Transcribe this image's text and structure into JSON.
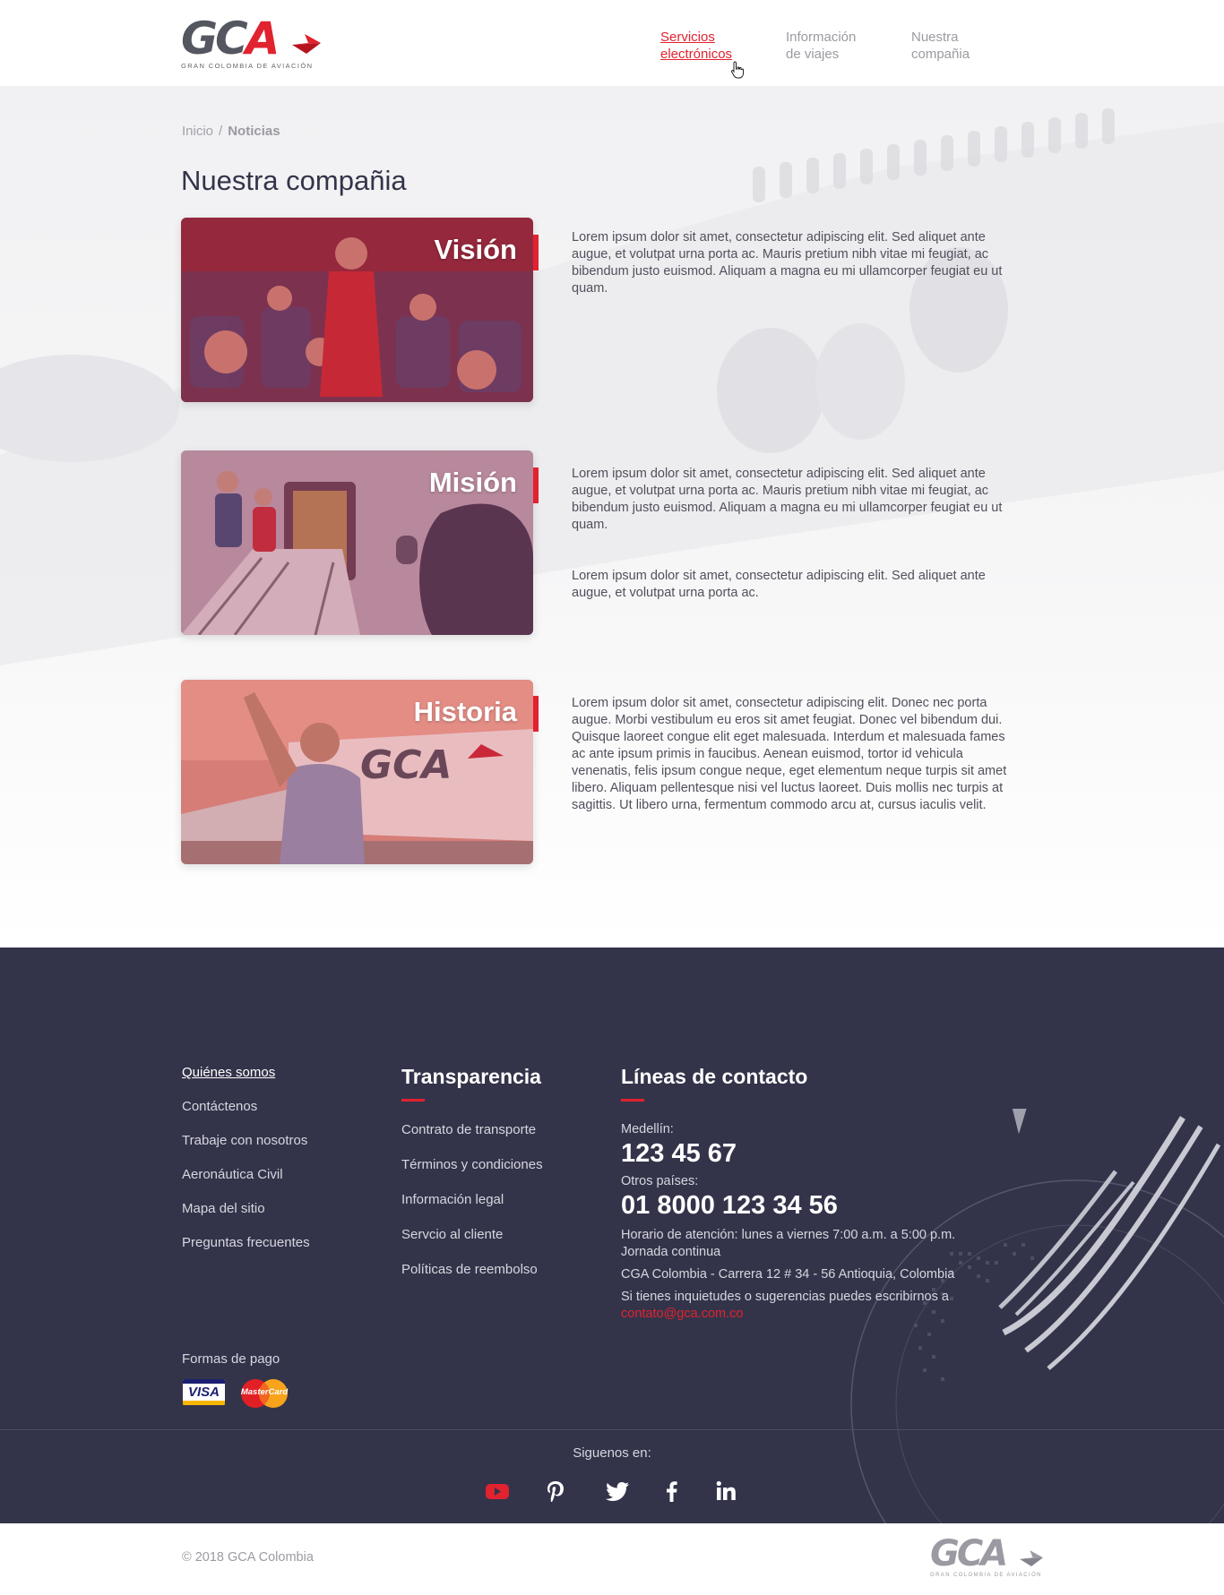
{
  "header": {
    "logo_text": "GCA",
    "logo_sub": "GRAN COLOMBIA DE AVIACIÓN",
    "nav": [
      {
        "line1": "Servicios",
        "line2": "electrónicos"
      },
      {
        "line1": "Información",
        "line2": "de viajes"
      },
      {
        "line1": "Nuestra",
        "line2": "compañia"
      }
    ]
  },
  "breadcrumb": {
    "home": "Inicio",
    "separator": "/",
    "current": "Noticias"
  },
  "page_title": "Nuestra compañia",
  "sections": [
    {
      "title": "Visión",
      "paragraphs": [
        "Lorem ipsum dolor sit amet, consectetur adipiscing elit. Sed aliquet ante augue, et volutpat urna porta ac. Mauris pretium nibh vitae mi feugiat, ac bibendum justo euismod. Aliquam a magna eu mi ullamcorper feugiat eu ut quam."
      ]
    },
    {
      "title": "Misión",
      "paragraphs": [
        "Lorem ipsum dolor sit amet, consectetur adipiscing elit. Sed aliquet ante augue, et volutpat urna porta ac. Mauris pretium nibh vitae mi feugiat, ac bibendum justo euismod. Aliquam a magna eu mi ullamcorper feugiat eu ut quam.",
        "Lorem ipsum dolor sit amet, consectetur adipiscing elit. Sed aliquet ante augue, et volutpat urna porta ac."
      ]
    },
    {
      "title": "Historia",
      "paragraphs": [
        "Lorem ipsum dolor sit amet, consectetur adipiscing elit. Donec nec porta augue. Morbi vestibulum eu eros sit amet feugiat. Donec vel bibendum dui. Quisque laoreet congue elit eget malesuada. Interdum et malesuada fames ac ante ipsum primis in faucibus. Aenean euismod, tortor id vehicula venenatis, felis ipsum congue neque, eget elementum neque turpis sit amet libero. Aliquam pellentesque nisi vel luctus laoreet. Duis mollis nec turpis at sagittis. Ut libero urna, fermentum commodo arcu at, cursus iaculis velit."
      ]
    }
  ],
  "footer": {
    "links_col1": [
      "Quiénes somos",
      "Contáctenos",
      "Trabaje con nosotros",
      "Aeronáutica Civil",
      "Mapa del sitio",
      "Preguntas frecuentes"
    ],
    "col2_heading": "Transparencia",
    "links_col2": [
      "Contrato de transporte",
      "Términos y condiciones",
      "Información legal",
      "Servcio al cliente",
      "Políticas de reembolso"
    ],
    "col3_heading": "Líneas de contacto",
    "medellin_label": "Medellín:",
    "medellin_phone": "123 45 67",
    "other_label": "Otros países:",
    "other_phone": "01 8000 123 34 56",
    "hours_line1": "Horario de atención: lunes a viernes 7:00 a.m. a 5:00 p.m.",
    "hours_line2": "Jornada continua",
    "address": "CGA Colombia - Carrera 12 # 34 - 56 Antioquia, Colombia",
    "suggestions": "Si tienes inquietudes o sugerencias puedes escribirnos a",
    "email": "contato@gca.com.co",
    "payments_label": "Formas de pago",
    "visa_text": "VISA",
    "mastercard_text": "MasterCard",
    "follow_label": "Siguenos en:",
    "social_icons": [
      "youtube-icon",
      "pinterest-icon",
      "twitter-icon",
      "facebook-icon",
      "linkedin-icon"
    ],
    "copyright": "© 2018 GCA Colombia"
  },
  "colors": {
    "accent": "#e1222f",
    "footer_bg": "#33344a",
    "title": "#33344a"
  }
}
